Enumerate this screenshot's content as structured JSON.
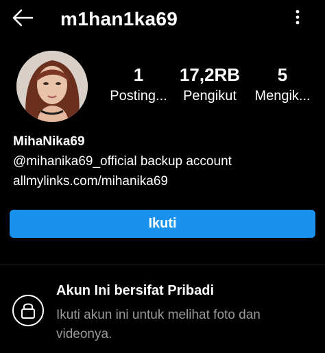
{
  "header": {
    "username": "m1han1ka69"
  },
  "stats": [
    {
      "value": "1",
      "label": "Posting..."
    },
    {
      "value": "17,2RB",
      "label": "Pengikut"
    },
    {
      "value": "5",
      "label": "Mengik..."
    }
  ],
  "bio": {
    "name": "MihaNika69",
    "line1": "@mihanika69_official backup account",
    "link": "allmylinks.com/mihanika69"
  },
  "follow_button": {
    "label": "Ikuti",
    "color": "#1a92ed"
  },
  "private_notice": {
    "title": "Akun Ini bersifat Pribadi",
    "description": "Ikuti akun ini untuk melihat foto dan videonya."
  },
  "icons": {
    "back": "arrow-left-icon",
    "more": "vertical-dots-icon",
    "lock": "lock-icon"
  }
}
